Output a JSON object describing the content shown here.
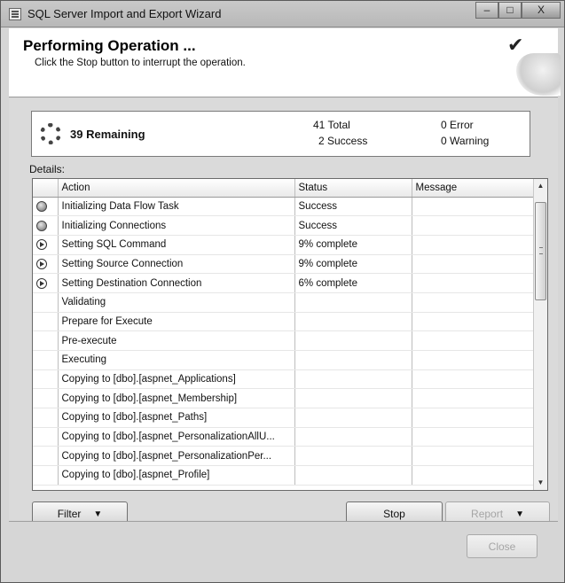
{
  "window": {
    "title": "SQL Server Import and Export Wizard",
    "minimize_glyph": "–",
    "maximize_glyph": "□",
    "close_glyph": "X"
  },
  "header": {
    "title": "Performing Operation ...",
    "subtitle": "Click the Stop button to interrupt the operation."
  },
  "summary": {
    "remaining": "39 Remaining",
    "total": "41 Total",
    "success": "2 Success",
    "error": "0 Error",
    "warning": "0 Warning"
  },
  "details": {
    "label": "Details:",
    "columns": [
      "Action",
      "Status",
      "Message"
    ],
    "rows": [
      {
        "icon": "success",
        "action": "Initializing Data Flow Task",
        "status": "Success",
        "message": ""
      },
      {
        "icon": "success",
        "action": "Initializing Connections",
        "status": "Success",
        "message": ""
      },
      {
        "icon": "in-progress",
        "action": "Setting SQL Command",
        "status": "9% complete",
        "message": ""
      },
      {
        "icon": "in-progress",
        "action": "Setting Source Connection",
        "status": "9% complete",
        "message": ""
      },
      {
        "icon": "in-progress",
        "action": "Setting Destination Connection",
        "status": "6% complete",
        "message": ""
      },
      {
        "icon": "",
        "action": "Validating",
        "status": "",
        "message": ""
      },
      {
        "icon": "",
        "action": "Prepare for Execute",
        "status": "",
        "message": ""
      },
      {
        "icon": "",
        "action": "Pre-execute",
        "status": "",
        "message": ""
      },
      {
        "icon": "",
        "action": "Executing",
        "status": "",
        "message": ""
      },
      {
        "icon": "",
        "action": "Copying to [dbo].[aspnet_Applications]",
        "status": "",
        "message": ""
      },
      {
        "icon": "",
        "action": "Copying to [dbo].[aspnet_Membership]",
        "status": "",
        "message": ""
      },
      {
        "icon": "",
        "action": "Copying to [dbo].[aspnet_Paths]",
        "status": "",
        "message": ""
      },
      {
        "icon": "",
        "action": "Copying to [dbo].[aspnet_PersonalizationAllU...",
        "status": "",
        "message": ""
      },
      {
        "icon": "",
        "action": "Copying to [dbo].[aspnet_PersonalizationPer...",
        "status": "",
        "message": ""
      },
      {
        "icon": "",
        "action": "Copying to [dbo].[aspnet_Profile]",
        "status": "",
        "message": ""
      }
    ]
  },
  "buttons": {
    "filter": "Filter",
    "stop": "Stop",
    "report": "Report",
    "close": "Close"
  }
}
